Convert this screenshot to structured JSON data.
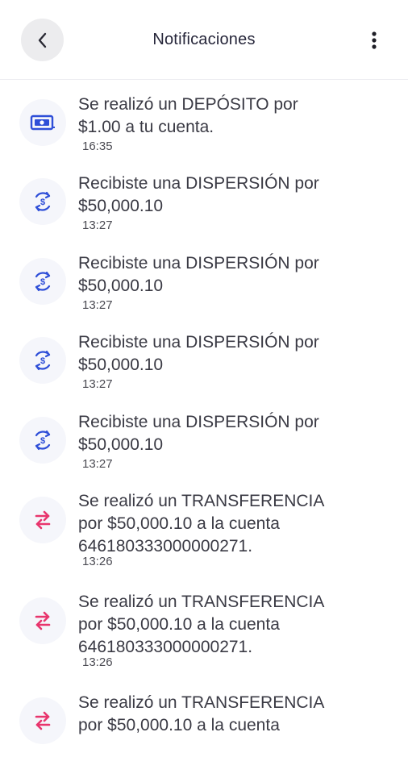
{
  "header": {
    "title": "Notificaciones",
    "back_icon": "chevron-left-icon",
    "menu_icon": "more-vertical-icon"
  },
  "colors": {
    "deposit": "#2f4fd8",
    "dispersion": "#2f4fd8",
    "transfer": "#e8356d",
    "icon_bg": "#f5f6fb"
  },
  "notifications": [
    {
      "type": "deposit",
      "icon": "cash-icon",
      "line1": "Se realizó un DEPÓSITO por",
      "line2": "$1.00 a tu cuenta.",
      "line3": "",
      "time": "16:35"
    },
    {
      "type": "dispersion",
      "icon": "dollar-cycle-icon",
      "line1": "Recibiste una DISPERSIÓN por",
      "line2": "$50,000.10",
      "line3": "",
      "time": "13:27"
    },
    {
      "type": "dispersion",
      "icon": "dollar-cycle-icon",
      "line1": "Recibiste una DISPERSIÓN por",
      "line2": "$50,000.10",
      "line3": "",
      "time": "13:27"
    },
    {
      "type": "dispersion",
      "icon": "dollar-cycle-icon",
      "line1": "Recibiste una DISPERSIÓN por",
      "line2": "$50,000.10",
      "line3": "",
      "time": "13:27"
    },
    {
      "type": "dispersion",
      "icon": "dollar-cycle-icon",
      "line1": "Recibiste una DISPERSIÓN por",
      "line2": "$50,000.10",
      "line3": "",
      "time": "13:27"
    },
    {
      "type": "transfer",
      "icon": "transfer-arrows-icon",
      "line1": "Se realizó un TRANSFERENCIA",
      "line2": "por $50,000.10 a la cuenta",
      "line3": "646180333000000271.",
      "time": "13:26"
    },
    {
      "type": "transfer",
      "icon": "transfer-arrows-icon",
      "line1": "Se realizó un TRANSFERENCIA",
      "line2": "por $50,000.10 a la cuenta",
      "line3": "646180333000000271.",
      "time": "13:26"
    },
    {
      "type": "transfer",
      "icon": "transfer-arrows-icon",
      "line1": "Se realizó un TRANSFERENCIA",
      "line2": "por $50,000.10 a la cuenta",
      "line3": "",
      "time": ""
    }
  ]
}
